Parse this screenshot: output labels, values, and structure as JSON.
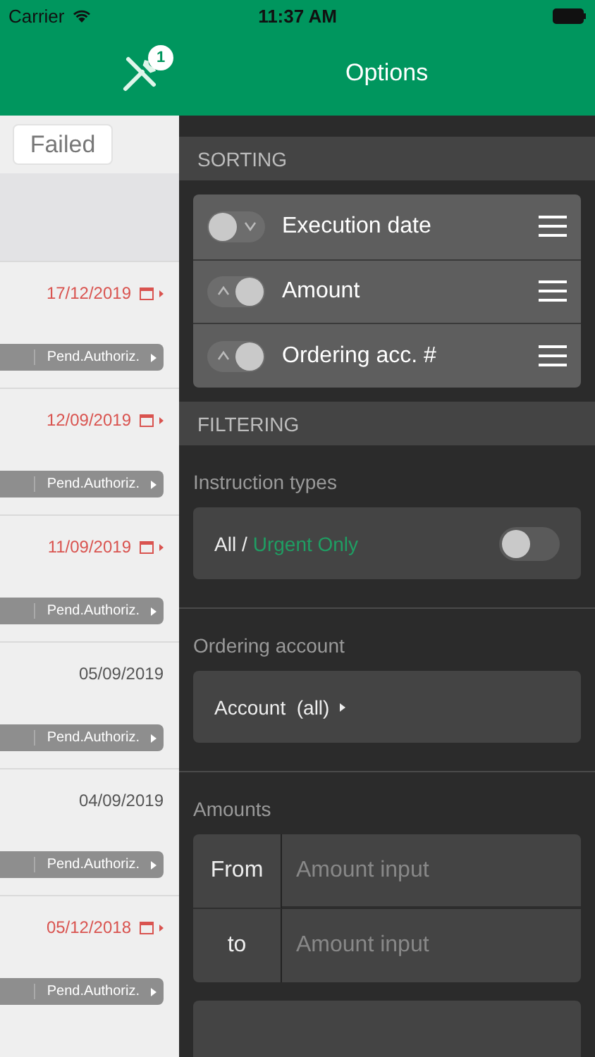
{
  "status_bar": {
    "carrier": "Carrier",
    "time": "11:37 AM"
  },
  "header": {
    "badge": "1",
    "title": "Options"
  },
  "list": {
    "filter_button": "Failed",
    "rows": [
      {
        "date": "17/12/2019",
        "overdue": true,
        "status": "Pend.Authoriz."
      },
      {
        "date": "12/09/2019",
        "overdue": true,
        "status": "Pend.Authoriz."
      },
      {
        "date": "11/09/2019",
        "overdue": true,
        "status": "Pend.Authoriz."
      },
      {
        "date": "05/09/2019",
        "overdue": false,
        "status": "Pend.Authoriz."
      },
      {
        "date": "04/09/2019",
        "overdue": false,
        "status": "Pend.Authoriz."
      },
      {
        "date": "05/12/2018",
        "overdue": true,
        "status": "Pend.Authoriz."
      }
    ]
  },
  "sorting": {
    "title": "SORTING",
    "items": [
      {
        "label": "Execution date",
        "ascending": false
      },
      {
        "label": "Amount",
        "ascending": true
      },
      {
        "label": "Ordering acc. #",
        "ascending": true
      }
    ]
  },
  "filtering": {
    "title": "FILTERING",
    "instruction_types": {
      "label": "Instruction types",
      "all": "All /",
      "urgent": "Urgent Only",
      "on": false
    },
    "ordering_account": {
      "label": "Ordering account",
      "value": "Account  (all)"
    },
    "amounts": {
      "label": "Amounts",
      "from_label": "From",
      "from_placeholder": "Amount input",
      "to_label": "to",
      "to_placeholder": "Amount input"
    }
  }
}
